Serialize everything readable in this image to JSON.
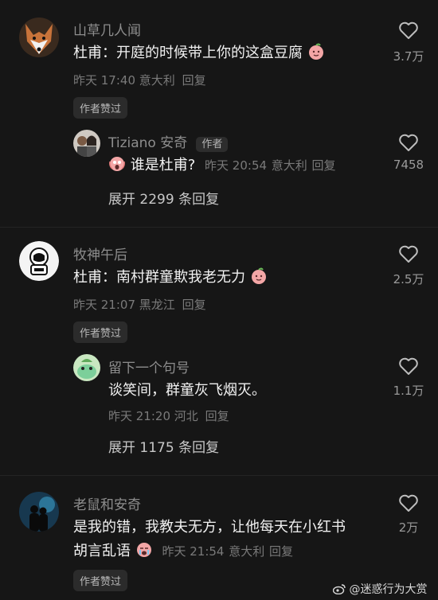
{
  "comments": [
    {
      "author": "山草几人闻",
      "text": "杜甫：开庭的时候带上你的这盒豆腐",
      "time": "昨天 17:40",
      "location": "意大利",
      "reply_label": "回复",
      "likes": "3.7万",
      "badge": "作者赞过",
      "reply": {
        "author": "Tiziano 安奇",
        "author_tag": "作者",
        "text": "谁是杜甫?",
        "time": "昨天 20:54",
        "location": "意大利",
        "reply_label": "回复",
        "likes": "7458"
      },
      "expand": "展开 2299 条回复"
    },
    {
      "author": "牧神午后",
      "text": "杜甫：南村群童欺我老无力",
      "time": "昨天 21:07",
      "location": "黑龙江",
      "reply_label": "回复",
      "likes": "2.5万",
      "badge": "作者赞过",
      "reply": {
        "author": "留下一个句号",
        "text": "谈笑间，群童灰飞烟灭。",
        "time": "昨天 21:20",
        "location": "河北",
        "reply_label": "回复",
        "likes": "1.1万"
      },
      "expand": "展开 1175 条回复"
    },
    {
      "author": "老鼠和安奇",
      "text_line1": "是我的错，我教夫无方，让他每天在小红书",
      "text_line2": "胡言乱语",
      "time": "昨天 21:54",
      "location": "意大利",
      "reply_label": "回复",
      "likes": "2万",
      "badge": "作者赞过"
    }
  ],
  "watermark": "@迷惑行为大赏",
  "icons": {
    "heart": "heart-outline-icon",
    "emoji_smile": "pink-smile-emoji",
    "emoji_shock": "scream-emoji",
    "emoji_cry": "crying-emoji"
  },
  "colors": {
    "background": "#161616",
    "accent_emoji": "#f3a6a6"
  }
}
